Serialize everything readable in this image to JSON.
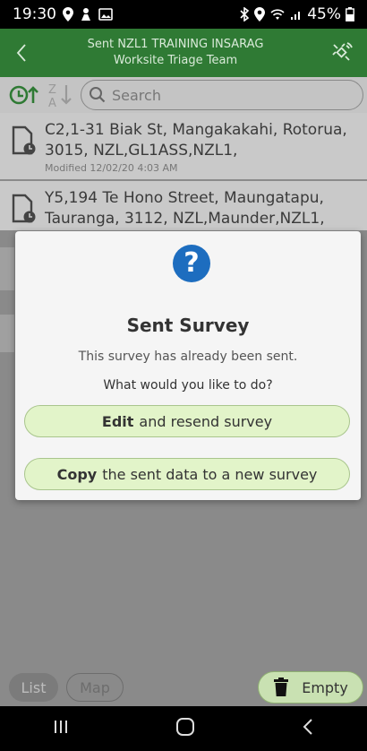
{
  "status_bar": {
    "time": "19:30",
    "battery_pct": "45%"
  },
  "header": {
    "title": "Sent NZL1 TRAINING INSARAG",
    "subtitle": "Worksite Triage Team"
  },
  "toolbar": {
    "search_placeholder": "Search"
  },
  "list": {
    "items": [
      {
        "text": "C2,1-31 Biak St, Mangakakahi, Rotorua, 3015, NZL,GL1ASS,NZL1,",
        "modified": "Modified 12/02/20 4:03 AM"
      },
      {
        "text": "Y5,194 Te Hono Street, Maungatapu, Tauranga, 3112, NZL,Maunder,NZL1,",
        "modified": ""
      }
    ]
  },
  "dialog": {
    "title": "Sent Survey",
    "message": "This survey has already been sent.",
    "question": "What would you like to do?",
    "edit_strong": "Edit",
    "edit_rest": "and resend survey",
    "copy_strong": "Copy",
    "copy_rest": "the sent data to a new survey"
  },
  "bottom": {
    "list_label": "List",
    "map_label": "Map",
    "empty_label": "Empty"
  },
  "colors": {
    "header_green": "#2f7a34",
    "accent_blue": "#1d6dbf",
    "button_green": "#e2f4c9"
  }
}
